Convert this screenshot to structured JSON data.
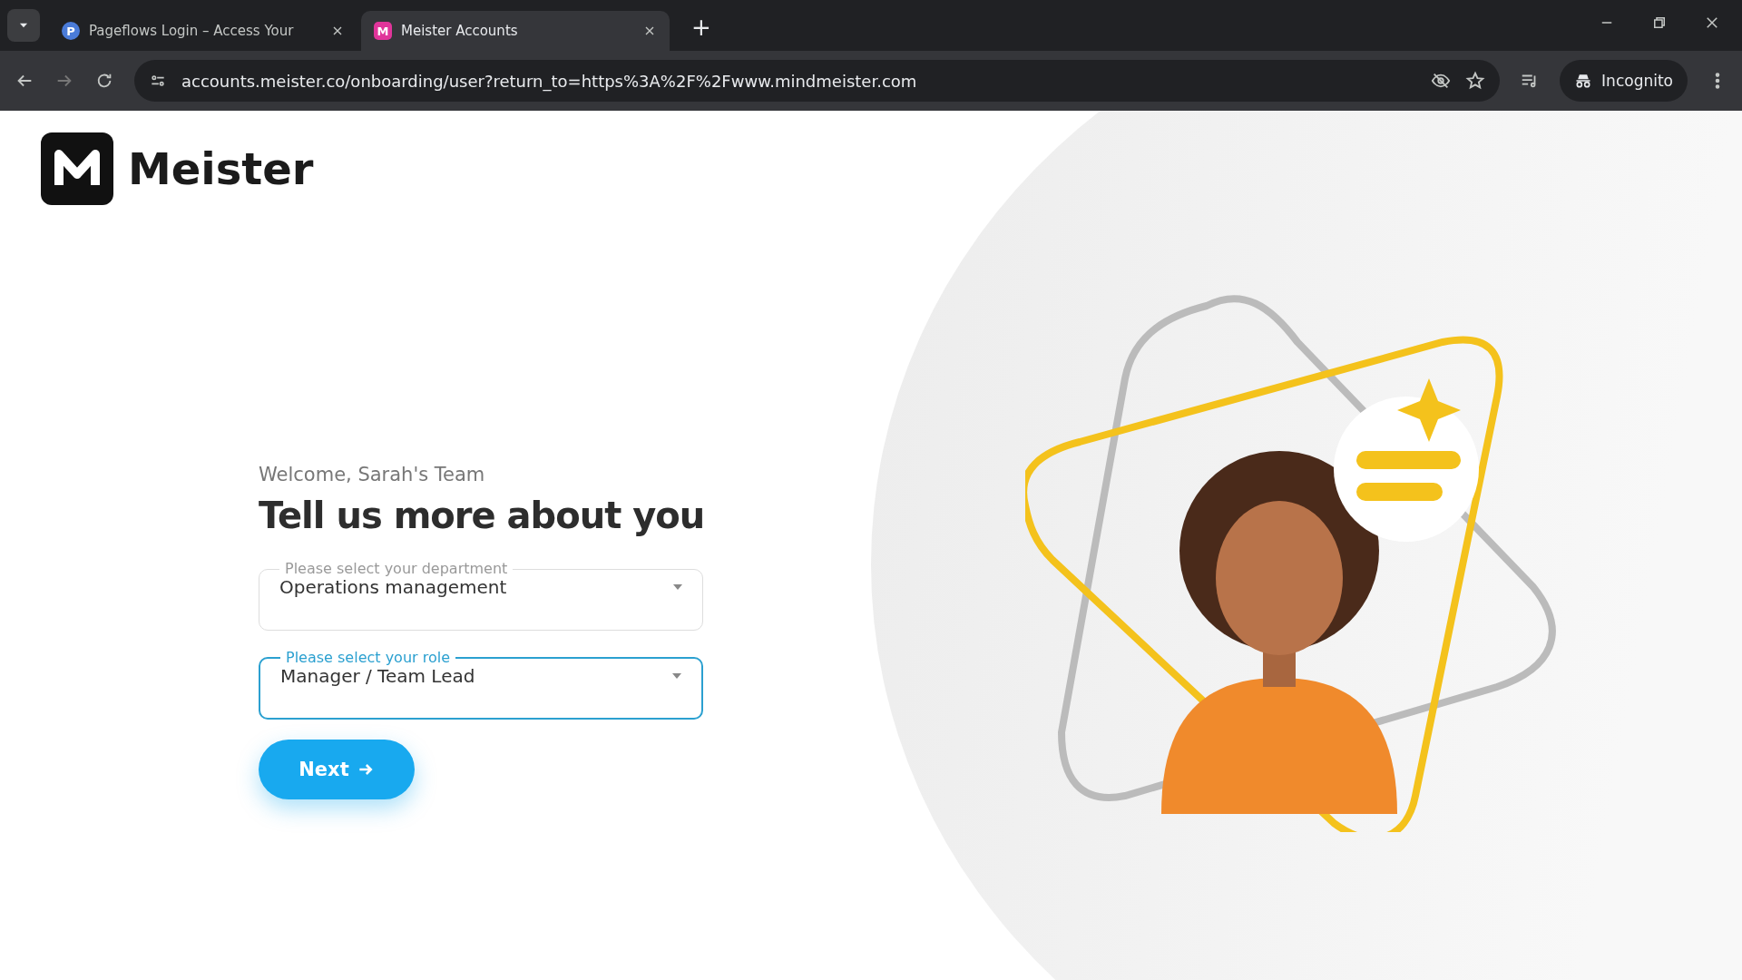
{
  "browser": {
    "tabs": [
      {
        "favicon": "P",
        "color": "#4a7bd8",
        "title": "Pageflows Login – Access Your",
        "selected": false
      },
      {
        "favicon": "M",
        "color": "#e0359a",
        "title": "Meister Accounts",
        "selected": true
      }
    ],
    "new_tab": "+",
    "url": "accounts.meister.co/onboarding/user?return_to=https%3A%2F%2Fwww.mindmeister.com",
    "profile": "Incognito"
  },
  "page": {
    "logo_text": "Meister",
    "welcome": "Welcome, Sarah's Team",
    "heading": "Tell us more about you",
    "fields": [
      {
        "label": "Please select your department",
        "value": "Operations management",
        "focused": false
      },
      {
        "label": "Please select your role",
        "value": "Manager / Team Lead",
        "focused": true
      }
    ],
    "next_button": "Next"
  }
}
